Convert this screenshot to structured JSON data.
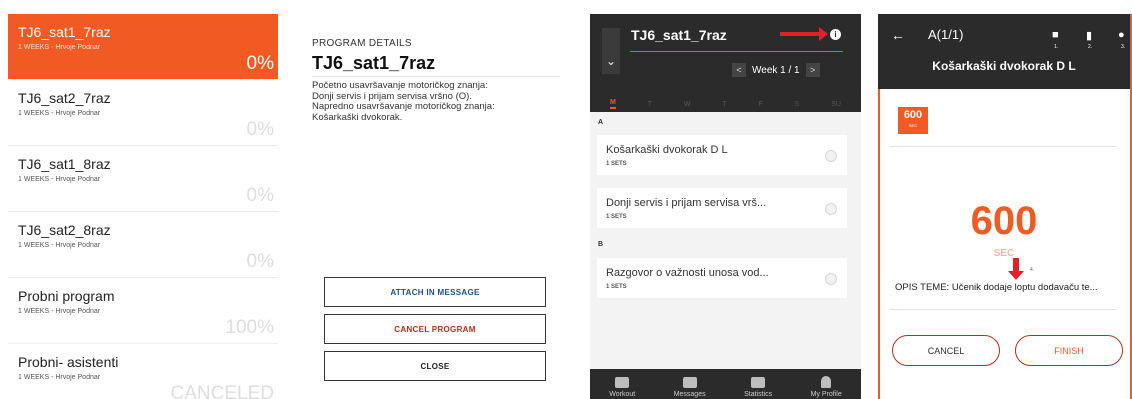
{
  "program_list": {
    "items": [
      {
        "name": "TJ6_sat1_7raz",
        "sub": "1 WEEKS - Hrvoje Podnar",
        "progress": "0%",
        "active": true
      },
      {
        "name": "TJ6_sat2_7raz",
        "sub": "1 WEEKS - Hrvoje Podnar",
        "progress": "0%"
      },
      {
        "name": "TJ6_sat1_8raz",
        "sub": "1 WEEKS - Hrvoje Podnar",
        "progress": "0%"
      },
      {
        "name": "TJ6_sat2_8raz",
        "sub": "1 WEEKS - Hrvoje Podnar",
        "progress": "0%"
      },
      {
        "name": "Probni program",
        "sub": "1 WEEKS - Hrvoje Podnar",
        "progress": "100%"
      },
      {
        "name": "Probni- asistenti",
        "sub": "1 WEEKS - Hrvoje Podnar",
        "progress": "CANCELED"
      }
    ],
    "accent_color": "#f15a22"
  },
  "program_details": {
    "label": "PROGRAM DETAILS",
    "title": "TJ6_sat1_7raz",
    "description": "Početno usavršavanje motoričkog znanja:\nDonji servis i prijam servisa vršno (O).\nNapredno usavršavanje motoričkog znanja:\nKošarkaški dvokorak.",
    "buttons": {
      "attach": "ATTACH IN MESSAGE",
      "cancel": "CANCEL PROGRAM",
      "close": "CLOSE"
    },
    "cancel_color": "#b52f18",
    "attach_color": "#1f4e8c"
  },
  "workout_week": {
    "title": "TJ6_sat1_7raz",
    "week_label": "Week 1 / 1",
    "prev": "<",
    "next": ">",
    "days": [
      "M",
      "T",
      "W",
      "T",
      "F",
      "S",
      "SU"
    ],
    "section_a": "A",
    "section_b": "B",
    "exercises": [
      {
        "name": "Košarkaški dvokorak D L",
        "sets": "1 SETS"
      },
      {
        "name": "Donji servis i prijam servisa vrš...",
        "sets": "1 SETS"
      },
      {
        "name": "Razgovor o važnosti unosa vod...",
        "sets": "1 SETS"
      }
    ],
    "info_icon": "info-icon",
    "dropdown_icon": "chevron-down-icon"
  },
  "tabbar": {
    "tabs": [
      "Workout",
      "Messages",
      "Statistics",
      "My Profile"
    ]
  },
  "exercise_timer": {
    "counter": "A(1/1)",
    "title": "Košarkaški dvokorak D L",
    "badge_value": "600",
    "badge_unit": "SEC",
    "timer_value": "600",
    "timer_unit": "SEC",
    "annotation_4": "4.",
    "description": "OPIS TEME: Učenik dodaje loptu dodavaču te...",
    "header_icon_numbers": [
      "1.",
      "2.",
      "3."
    ],
    "cancel_label": "CANCEL",
    "finish_label": "FINISH"
  }
}
